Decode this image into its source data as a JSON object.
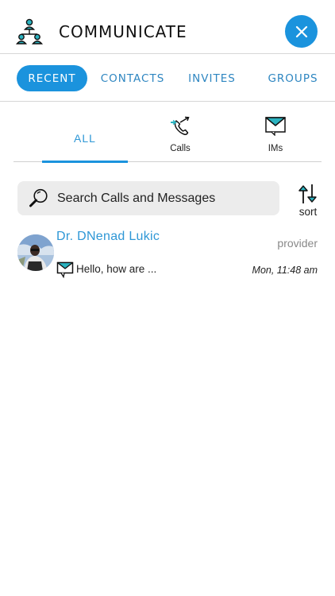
{
  "header": {
    "title": "COMMUNICATE",
    "app_icon": "people-network-icon",
    "close_icon": "close-icon"
  },
  "top_tabs": [
    {
      "label": "RECENT",
      "active": true
    },
    {
      "label": "CONTACTS",
      "active": false
    },
    {
      "label": "INVITES",
      "active": false
    },
    {
      "label": "GROUPS",
      "active": false
    }
  ],
  "sub_tabs": [
    {
      "label": "ALL",
      "active": true
    },
    {
      "label": "Calls",
      "icon": "phone-arrows-icon",
      "active": false
    },
    {
      "label": "IMs",
      "icon": "envelope-icon",
      "active": false
    }
  ],
  "search": {
    "placeholder": "Search Calls and Messages",
    "icon": "search-icon"
  },
  "sort": {
    "label": "sort",
    "icon": "sort-arrows-icon"
  },
  "conversations": [
    {
      "name": "Dr. DNenad Lukic",
      "role": "provider",
      "preview": "Hello, how are ...",
      "time": "Mon, 11:48 am",
      "type_icon": "message-bubble-icon"
    }
  ],
  "colors": {
    "accent": "#1b93dd",
    "link": "#2e97d6",
    "search_bg": "#ececec"
  }
}
